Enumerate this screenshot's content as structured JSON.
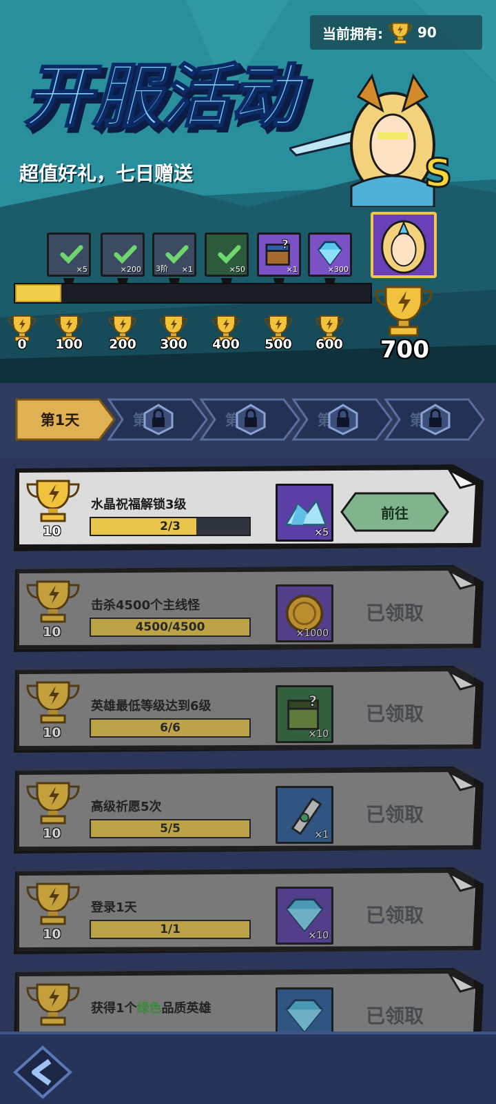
{
  "header": {
    "owned_label": "当前拥有:",
    "owned_value": "90",
    "title": "开服活动",
    "subtitle": "超值好礼，七日赠送",
    "hero_grade": "S"
  },
  "milestones": {
    "progress_fraction": 0.13,
    "points": [
      {
        "value": "0"
      },
      {
        "value": "100"
      },
      {
        "value": "200"
      },
      {
        "value": "300"
      },
      {
        "value": "400"
      },
      {
        "value": "500"
      },
      {
        "value": "600"
      }
    ],
    "final": {
      "value": "700"
    },
    "rewards": [
      {
        "qty": "×5",
        "grade": "",
        "claimed": true,
        "icon": "check-icon"
      },
      {
        "qty": "×200",
        "grade": "",
        "claimed": true,
        "icon": "check-icon"
      },
      {
        "qty": "×1",
        "grade": "3阶",
        "claimed": true,
        "icon": "check-icon"
      },
      {
        "qty": "×50",
        "grade": "",
        "claimed": true,
        "icon": "check-icon"
      },
      {
        "qty": "×1",
        "grade": "",
        "claimed": false,
        "icon": "mystery-chest-icon"
      },
      {
        "qty": "×300",
        "grade": "",
        "claimed": false,
        "icon": "diamond-icon"
      }
    ]
  },
  "tabs": [
    {
      "label": "第1天",
      "active": true
    },
    {
      "label": "第2天",
      "active": false
    },
    {
      "label": "第3天",
      "active": false
    },
    {
      "label": "第4天",
      "active": false
    },
    {
      "label": "第5天",
      "active": false
    }
  ],
  "tasks": [
    {
      "points": "10",
      "name": "水晶祝福解锁3级",
      "progress_text": "2/3",
      "progress_fraction": 0.667,
      "qty": "×5",
      "item_icon": "crystal-icon",
      "item_color": "#5b3fa6",
      "status": "go",
      "action_label": "前往"
    },
    {
      "points": "10",
      "name": "击杀4500个主线怪",
      "progress_text": "4500/4500",
      "progress_fraction": 1.0,
      "qty": "×1000",
      "item_icon": "gold-coin-icon",
      "item_color": "#5b3fa6",
      "status": "claimed",
      "action_label": "已领取"
    },
    {
      "points": "10",
      "name": "英雄最低等级达到6级",
      "progress_text": "6/6",
      "progress_fraction": 1.0,
      "qty": "×10",
      "item_icon": "mystery-chest-icon",
      "item_color": "#2f6b3e",
      "status": "claimed",
      "action_label": "已领取"
    },
    {
      "points": "10",
      "name": "高级祈愿5次",
      "progress_text": "5/5",
      "progress_fraction": 1.0,
      "qty": "×1",
      "item_icon": "scroll-icon",
      "item_color": "#2e5e9a",
      "status": "claimed",
      "action_label": "已领取"
    },
    {
      "points": "10",
      "name": "登录1天",
      "progress_text": "1/1",
      "progress_fraction": 1.0,
      "qty": "×10",
      "item_icon": "diamond-icon",
      "item_color": "#5b3fa6",
      "status": "claimed",
      "action_label": "已领取"
    },
    {
      "points": "",
      "name": "获得1个",
      "name_highlight": "绿色",
      "name_suffix": "品质英雄",
      "progress_text": "",
      "progress_fraction": 0,
      "qty": "",
      "item_icon": "diamond-icon",
      "item_color": "#2e5e9a",
      "status": "claimed",
      "action_label": "已领取"
    }
  ],
  "colors": {
    "gold": "#f1cf4b",
    "go_button": "#7fb48c",
    "card_active": "#dcdcdc",
    "card_done": "#8e8e8e"
  }
}
